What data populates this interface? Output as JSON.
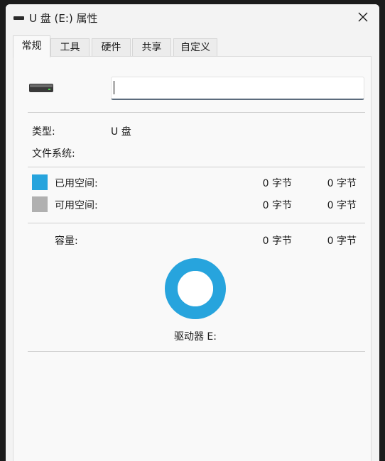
{
  "window": {
    "title": "U 盘 (E:) 属性"
  },
  "tabs": [
    {
      "label": "常规",
      "active": true
    },
    {
      "label": "工具",
      "active": false
    },
    {
      "label": "硬件",
      "active": false
    },
    {
      "label": "共享",
      "active": false
    },
    {
      "label": "自定义",
      "active": false
    }
  ],
  "general": {
    "name_value": "",
    "type_label": "类型:",
    "type_value": "U 盘",
    "filesystem_label": "文件系统:",
    "filesystem_value": "",
    "used_label": "已用空间:",
    "used_bytes": "0 字节",
    "used_size": "0 字节",
    "free_label": "可用空间:",
    "free_bytes": "0 字节",
    "free_size": "0 字节",
    "capacity_label": "容量:",
    "capacity_bytes": "0 字节",
    "capacity_size": "0 字节",
    "drive_label": "驱动器 E:"
  },
  "colors": {
    "used": "#27a4dd",
    "free": "#b0b0b0",
    "donut": "#27a4dd"
  },
  "icons": {
    "title": "drive-icon",
    "close": "close-icon",
    "drive": "usb-drive-icon",
    "chart": "donut-chart"
  }
}
